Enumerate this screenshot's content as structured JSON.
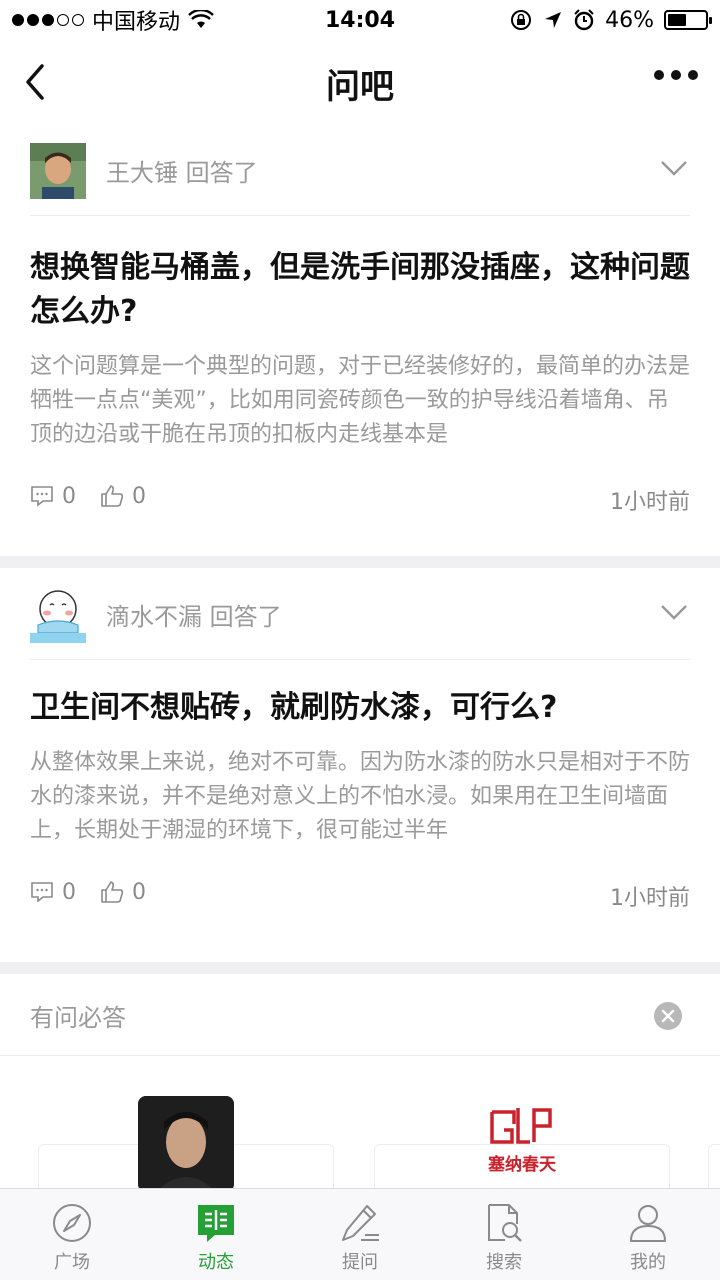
{
  "status_bar": {
    "carrier": "中国移动",
    "time": "14:04",
    "battery": "46%"
  },
  "nav": {
    "title": "问吧"
  },
  "posts": [
    {
      "user": "王大锤",
      "action": "回答了",
      "title": "想换智能马桶盖，但是洗手间那没插座，这种问题怎么办?",
      "body": "这个问题算是一个典型的问题，对于已经装修好的，最简单的办法是牺牲一点点“美观”，比如用同瓷砖颜色一致的护导线沿着墙角、吊顶的边沿或干脆在吊顶的扣板内走线基本是",
      "comments": "0",
      "likes": "0",
      "time": "1小时前"
    },
    {
      "user": "滴水不漏",
      "action": "回答了",
      "title": "卫生间不想贴砖，就刷防水漆，可行么?",
      "body": "从整体效果上来说，绝对不可靠。因为防水漆的防水只是相对于不防水的漆来说，并不是绝对意义上的不怕水浸。如果用在卫生间墙面上，长期处于潮湿的环境下，很可能过半年",
      "comments": "0",
      "likes": "0",
      "time": "1小时前"
    }
  ],
  "section": {
    "label": "有问必答",
    "logo_text": "塞纳春天"
  },
  "tabbar": {
    "items": [
      "广场",
      "动态",
      "提问",
      "搜索",
      "我的"
    ],
    "active_color": "#25a035"
  }
}
